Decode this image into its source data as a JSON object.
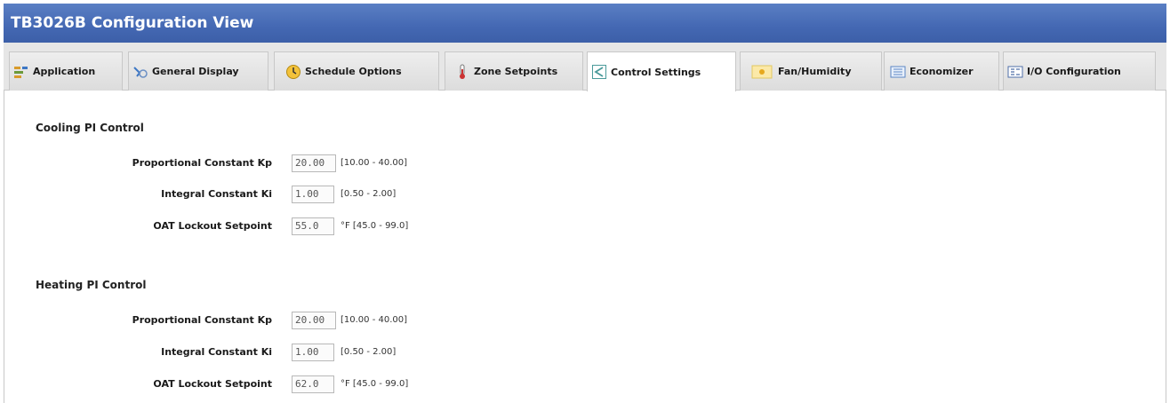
{
  "window": {
    "title": "TB3026B Configuration View"
  },
  "tabs": [
    {
      "label": "Application",
      "icon": "application-icon"
    },
    {
      "label": "General Display",
      "icon": "display-icon"
    },
    {
      "label": "Schedule Options",
      "icon": "clock-icon"
    },
    {
      "label": "Zone Setpoints",
      "icon": "thermometer-icon"
    },
    {
      "label": "Control Settings",
      "icon": "control-icon",
      "active": true
    },
    {
      "label": "Fan/Humidity",
      "icon": "fan-icon"
    },
    {
      "label": "Economizer",
      "icon": "economizer-icon"
    },
    {
      "label": "I/O Configuration",
      "icon": "io-icon"
    }
  ],
  "cooling": {
    "title": "Cooling PI Control",
    "rows": [
      {
        "label": "Proportional Constant Kp",
        "value": "20.00",
        "unit": "[10.00 - 40.00]"
      },
      {
        "label": "Integral Constant Ki",
        "value": "1.00",
        "unit": "[0.50 - 2.00]"
      },
      {
        "label": "OAT Lockout Setpoint",
        "value": "55.0",
        "unit": "°F [45.0 - 99.0]"
      }
    ]
  },
  "heating": {
    "title": "Heating PI Control",
    "rows": [
      {
        "label": "Proportional Constant Kp",
        "value": "20.00",
        "unit": "[10.00 - 40.00]"
      },
      {
        "label": "Integral Constant Ki",
        "value": "1.00",
        "unit": "[0.50 - 2.00]"
      },
      {
        "label": "OAT Lockout Setpoint",
        "value": "62.0",
        "unit": "°F [45.0 - 99.0]"
      }
    ]
  }
}
